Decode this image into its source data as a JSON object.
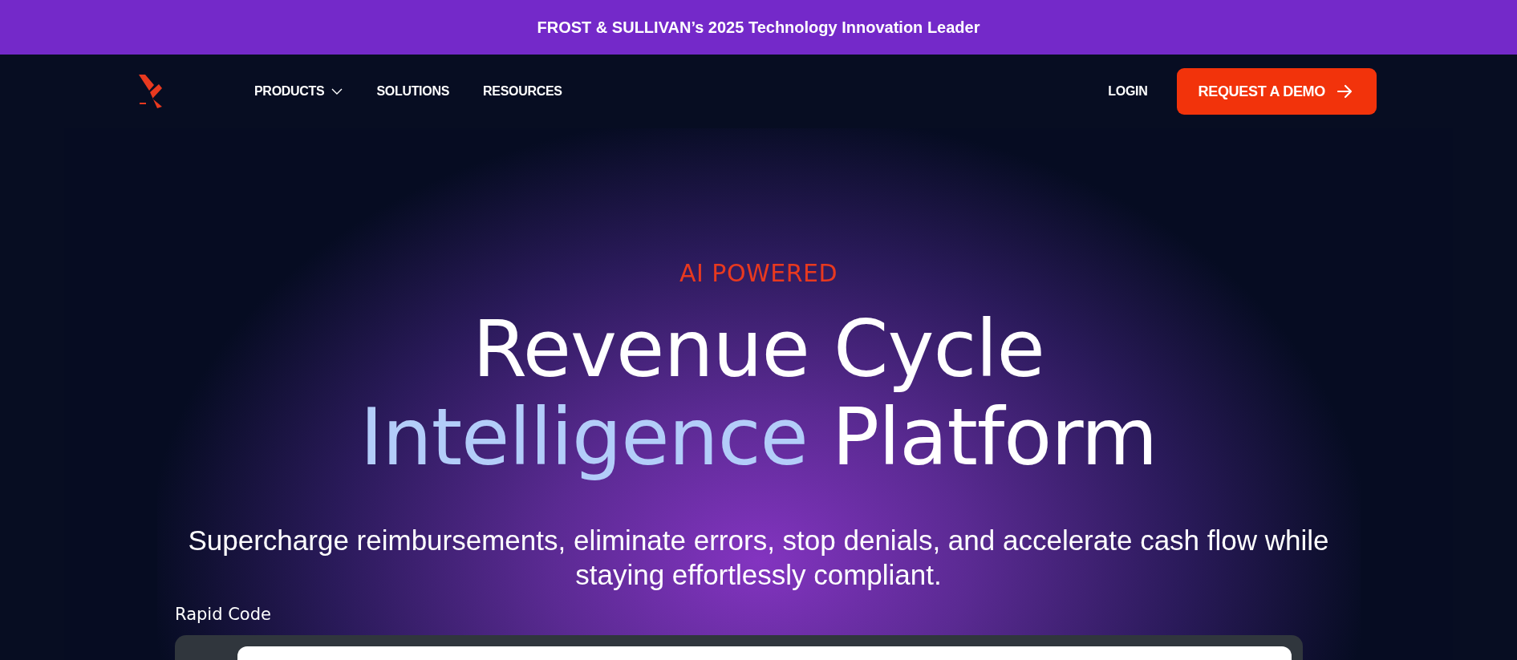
{
  "banner": {
    "text": "FROST & SULLIVAN’s 2025 Technology Innovation Leader"
  },
  "nav": {
    "items": [
      {
        "label": "PRODUCTS",
        "dropdown": true
      },
      {
        "label": "SOLUTIONS",
        "dropdown": false
      },
      {
        "label": "RESOURCES",
        "dropdown": false
      }
    ],
    "login": "LOGIN",
    "cta": "REQUEST A DEMO"
  },
  "hero": {
    "eyebrow": "AI POWERED",
    "title_line1": "Revenue Cycle",
    "title_highlight": "Intelligence",
    "title_rest": "Platform",
    "subtitle": "Supercharge reimbursements, eliminate errors, stop denials, and accelerate cash flow while staying effortlessly compliant.",
    "tab_label": "Rapid Code"
  }
}
